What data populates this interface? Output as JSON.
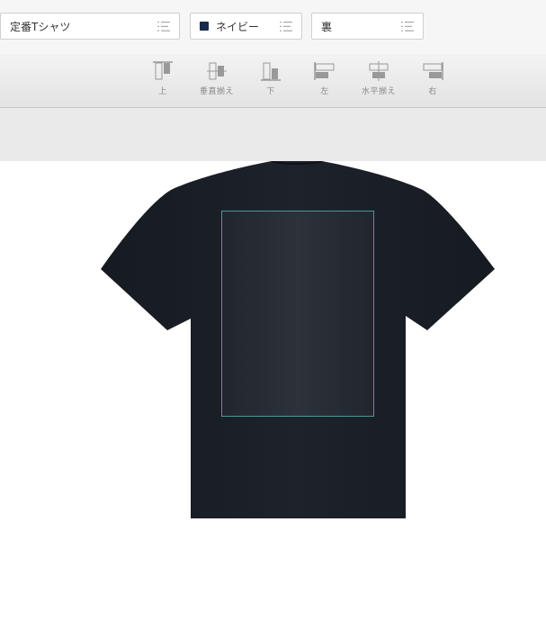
{
  "selectors": {
    "product": "定番Tシャツ",
    "color": "ネイビー",
    "color_swatch": "#1a2a4a",
    "side": "裏"
  },
  "align": {
    "top": "上",
    "vcenter": "垂直揃え",
    "bottom": "下",
    "left": "左",
    "hcenter": "水平揃え",
    "right": "右"
  },
  "colors": {
    "shirt": "#1b1f27",
    "print_area_border": "#4a9a96"
  }
}
